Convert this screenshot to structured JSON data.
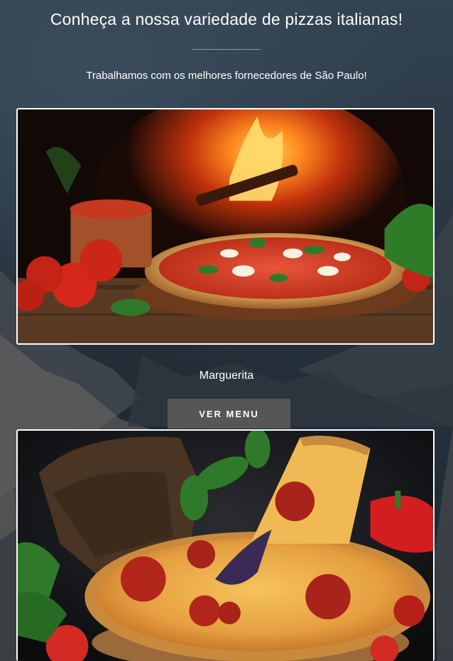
{
  "header": {
    "title": "Conheça a nossa variedade de pizzas italianas!",
    "subtitle": "Trabalhamos com os melhores fornecedores de São Paulo!"
  },
  "pizzas": [
    {
      "name": "Marguerita",
      "button_label": "VER MENU"
    },
    {
      "name": ""
    }
  ],
  "colors": {
    "button_bg": "#565656",
    "card_border": "#ffffff",
    "background": "#2a3743"
  }
}
